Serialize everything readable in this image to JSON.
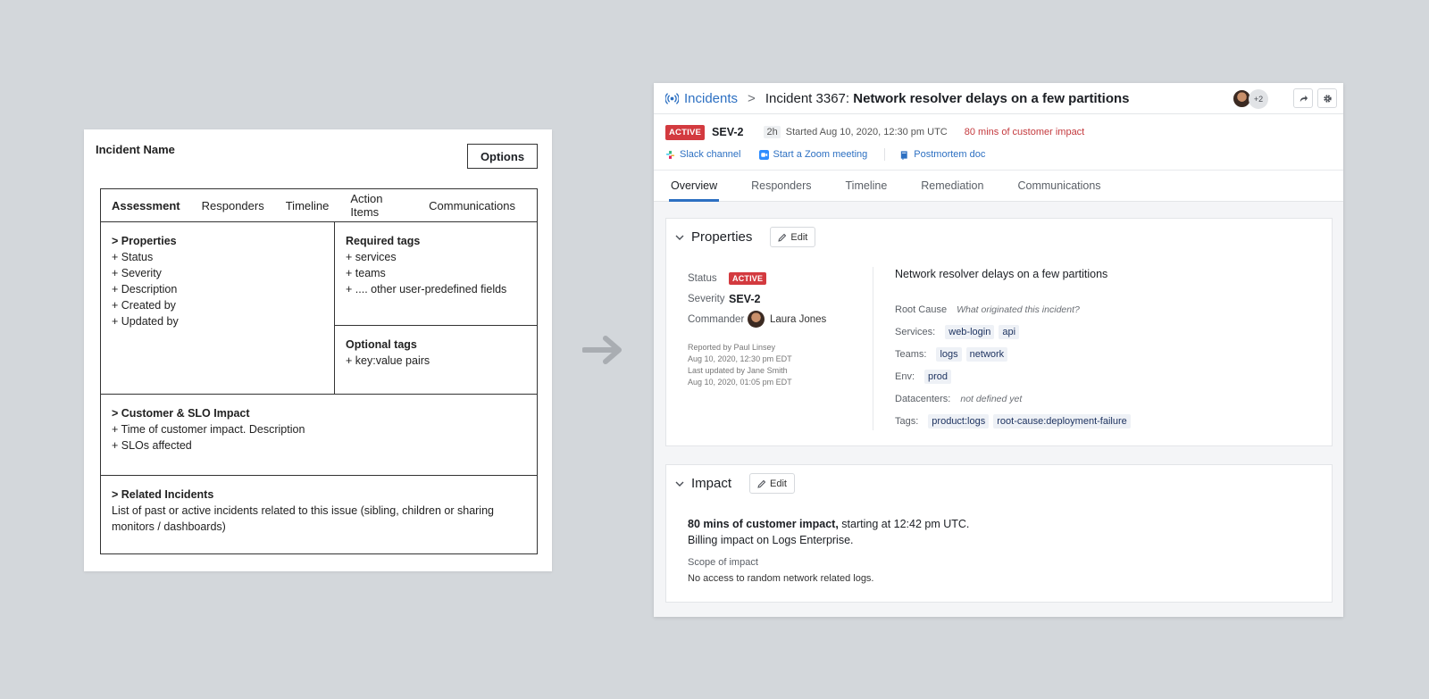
{
  "wireframe": {
    "title": "Incident Name",
    "options_label": "Options",
    "tabs": [
      "Assessment",
      "Responders",
      "Timeline",
      "Action Items",
      "Communications"
    ],
    "properties": {
      "heading": "> Properties",
      "items": [
        "+ Status",
        "+ Severity",
        "+ Description",
        "+ Created by",
        "+ Updated by"
      ]
    },
    "required_tags": {
      "heading": "Required tags",
      "items": [
        "+ services",
        "+ teams",
        "+ .... other user-predefined fields"
      ]
    },
    "optional_tags": {
      "heading": "Optional tags",
      "items": [
        "+ key:value pairs"
      ]
    },
    "customer_slo": {
      "heading": "> Customer & SLO Impact",
      "items": [
        "+ Time of customer impact. Description",
        "+ SLOs affected"
      ]
    },
    "related": {
      "heading": "> Related Incidents",
      "text": "List of past or active incidents related to this issue (sibling, children or sharing monitors / dashboards)"
    }
  },
  "app": {
    "breadcrumb": {
      "root": "Incidents",
      "separator": ">",
      "prefix": "Incident 3367: ",
      "title": "Network resolver delays on a few partitions"
    },
    "extra_avatars": "+2",
    "status_badge": "ACTIVE",
    "severity": "SEV-2",
    "duration": "2h",
    "started": "Started Aug 10, 2020, 12:30 pm UTC",
    "customer_impact": "80 mins of customer impact",
    "links": {
      "slack": "Slack channel",
      "zoom": "Start a Zoom meeting",
      "postmortem": "Postmortem doc"
    },
    "tabs": [
      "Overview",
      "Responders",
      "Timeline",
      "Remediation",
      "Communications"
    ],
    "properties": {
      "title": "Properties",
      "edit_label": "Edit",
      "status_label": "Status",
      "status_value": "ACTIVE",
      "severity_label": "Severity",
      "severity_value": "SEV-2",
      "commander_label": "Commander",
      "commander_name": "Laura Jones",
      "reported_by": "Reported by Paul Linsey",
      "reported_at": "Aug 10, 2020, 12:30 pm EDT",
      "updated_by": "Last updated by Jane Smith",
      "updated_at": "Aug 10, 2020, 01:05 pm EDT",
      "description": "Network resolver delays on a few partitions",
      "root_cause_label": "Root Cause",
      "root_cause_placeholder": "What originated this incident?",
      "services_label": "Services:",
      "services": [
        "web-login",
        "api"
      ],
      "teams_label": "Teams:",
      "teams": [
        "logs",
        "network"
      ],
      "env_label": "Env:",
      "env": [
        "prod"
      ],
      "datacenters_label": "Datacenters:",
      "datacenters_value": "not defined yet",
      "tags_label": "Tags:",
      "tags": [
        "product:logs",
        "root-cause:deployment-failure"
      ]
    },
    "impact": {
      "title": "Impact",
      "edit_label": "Edit",
      "summary_bold": "80 mins of customer impact,",
      "summary_rest": " starting at 12:42 pm UTC.",
      "billing": "Billing impact on Logs Enterprise.",
      "scope_label": "Scope of impact",
      "scope_value": "No access to random network related logs."
    }
  },
  "colors": {
    "accent": "#2d70c2",
    "danger": "#d33a3f",
    "background": "#d3d7db"
  }
}
